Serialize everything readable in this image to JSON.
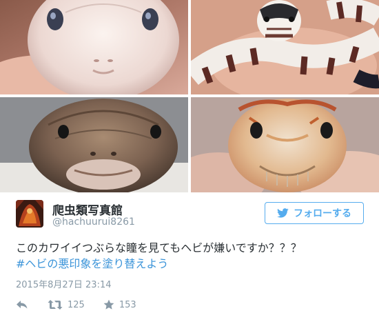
{
  "photos": [
    {
      "name": "white-snake-closeup"
    },
    {
      "name": "banded-kingsnake"
    },
    {
      "name": "brown-snake-closeup"
    },
    {
      "name": "corn-snake-closeup"
    }
  ],
  "tweet": {
    "display_name": "爬虫類写真館",
    "handle": "@hachuurui8261",
    "follow_label": "フォローする",
    "text": "このカワイイつぶらな瞳を見てもヘビが嫌いですか？？？",
    "hashtag": "#ヘビの悪印象を塗り替えよう",
    "timestamp": "2015年8月27日 23:14",
    "retweet_count": "125",
    "like_count": "153"
  },
  "colors": {
    "accent": "#55acee",
    "hashtag": "#3b94d9",
    "muted": "#8899a6",
    "text": "#292f33"
  },
  "icons": {
    "follow": "bird-icon",
    "reply": "reply-icon",
    "retweet": "retweet-icon",
    "like": "star-icon"
  }
}
